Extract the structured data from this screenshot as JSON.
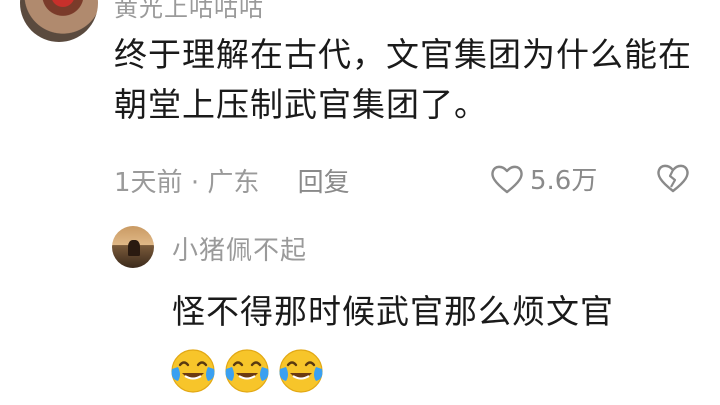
{
  "comment": {
    "username": "黄光上咕咕咕",
    "text": "终于理解在古代，文官集团为什么能在朝堂上压制武官集团了。",
    "time": "1天前",
    "separator": "·",
    "location": "广东",
    "reply_label": "回复",
    "likes": "5.6万",
    "like_icon": "heart-outline-icon",
    "dislike_icon": "broken-heart-icon"
  },
  "reply": {
    "username": "小猪佩不起",
    "text": "怪不得那时候武官那么烦文官",
    "emojis": [
      "crying-laughing-emoji",
      "crying-laughing-emoji",
      "crying-laughing-emoji"
    ]
  },
  "colors": {
    "text": "#1a1a1a",
    "muted": "#9a9a9a",
    "emoji_face": "#f7c52a",
    "emoji_tear": "#3aa0f0"
  }
}
